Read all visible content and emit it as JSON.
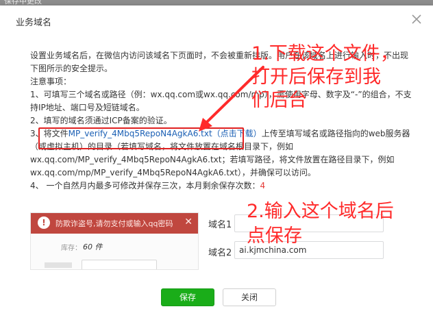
{
  "window": {
    "background_strip_text": "保存中更改"
  },
  "dialog": {
    "title": "业务域名",
    "close_icon": "close-icon"
  },
  "intro": "设置业务域名后，在微信内访问该域名下页面时，不会被重新排版。用户在该域名上进行输入时，不出现下图所示的安全提示。",
  "notes_title": "注意事项：",
  "notes": [
    "1、可填写三个域名或路径（例：wx.qq.com或wx.qq.com/mp），需使用字母、数字及“-”的组合，不支持IP地址、端口号及短链域名。",
    "2、填写的域名须通过ICP备案的验证。"
  ],
  "note3": {
    "prefix": "3、",
    "file_prefix": "将文件",
    "file_name": "MP_verify_4Mbq5RepoN4AgkA6.txt",
    "download_link": "（点击下载）",
    "rest": "上传至填写域名或路径指向的web服务器（或虚拟主机）的目录（若填写域名，将文件放置在域名根目录下，例如wx.qq.com/MP_verify_4Mbq5RepoN4AgkA6.txt；若填写路径，将文件放置在路径目录下，例如wx.qq.com/mp/MP_verify_4Mbq5RepoN4AgkA6.txt），并确保可以访问。"
  },
  "note4": {
    "text": "4、 一个自然月内最多可修改并保存三次，本月剩余保存次数：",
    "remaining": "4"
  },
  "preview": {
    "warning_text": "防欺诈盗号,请勿支付或输入qq密码",
    "stock_label": "库存：",
    "stock_value": "60 件",
    "icons": [
      "warning-icon",
      "close-icon"
    ]
  },
  "fields": [
    {
      "label": "域名1",
      "value": ""
    },
    {
      "label": "域名2",
      "value": "ai.kjmchina.com"
    }
  ],
  "buttons": {
    "save": "保存",
    "close": "关闭"
  },
  "annotations": {
    "step1": [
      "1.下载这个文件，",
      "打开后保存到我",
      "们后台"
    ],
    "step2": [
      "2.输入这个域名后",
      "点保存"
    ]
  },
  "colors": {
    "primary_green": "#1aad19",
    "annotation_red": "#ff2a2a",
    "link_blue": "#1a5fb4",
    "warning_red": "#c0473f"
  }
}
